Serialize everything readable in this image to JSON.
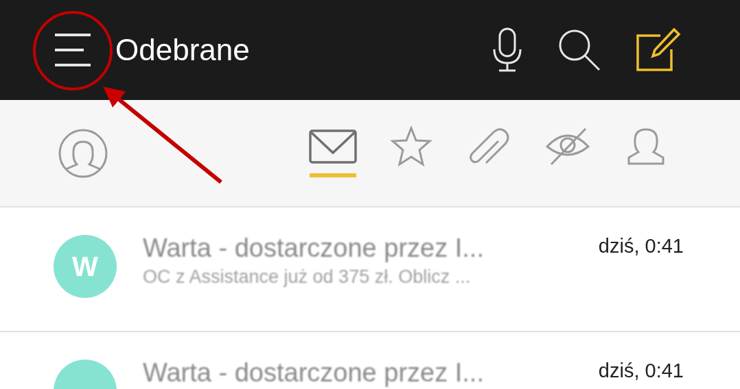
{
  "header": {
    "title": "Odebrane"
  },
  "filter_tabs": [
    {
      "kind": "mail",
      "selected": true
    },
    {
      "kind": "star",
      "selected": false
    },
    {
      "kind": "attachment",
      "selected": false
    },
    {
      "kind": "unread",
      "selected": false
    },
    {
      "kind": "contact",
      "selected": false
    }
  ],
  "messages": [
    {
      "avatar_letter": "W",
      "sender": "Warta - dostarczone przez I...",
      "preview": "OC z Assistance już od 375 zł. Oblicz ...",
      "time": "dziś, 0:41"
    },
    {
      "sender": "Warta - dostarczone przez I...",
      "time": "dziś, 0:41"
    }
  ]
}
